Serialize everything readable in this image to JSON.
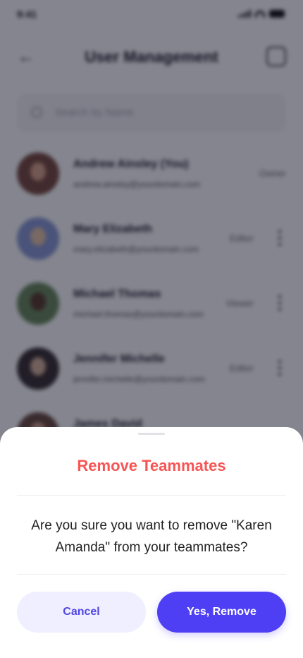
{
  "status_bar": {
    "time": "9:41"
  },
  "header": {
    "title": "User Management"
  },
  "search": {
    "placeholder": "Search by Name"
  },
  "users": [
    {
      "name": "Andrew Ainsley (You)",
      "email": "andrew.ainsley@yourdomain.com",
      "role": "Owner"
    },
    {
      "name": "Mary Elizabeth",
      "email": "mary.elizabeth@yourdomain.com",
      "role": "Editor"
    },
    {
      "name": "Michael Thomas",
      "email": "michael.thomas@yourdomain.com",
      "role": "Viewer"
    },
    {
      "name": "Jennifer Michelle",
      "email": "jennifer.michelle@yourdomain.com",
      "role": "Editor"
    },
    {
      "name": "James David",
      "email": "",
      "role": ""
    }
  ],
  "dialog": {
    "title": "Remove Teammates",
    "message": "Are you sure you want to remove \"Karen Amanda\" from your teammates?",
    "cancel_label": "Cancel",
    "confirm_label": "Yes, Remove"
  },
  "colors": {
    "danger": "#F75555",
    "primary": "#4F3FF4",
    "primary_light": "#F0EFFF"
  }
}
